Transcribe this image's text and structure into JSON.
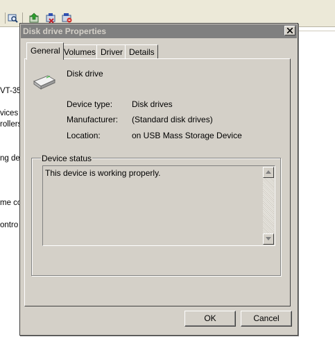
{
  "background_window": {
    "fragments": [
      "VT-35",
      "vices",
      "rollers",
      "ng de",
      "me co",
      "ontro"
    ]
  },
  "toolbar": {
    "icons": [
      "scan-hardware-icon",
      "update-driver-icon",
      "disable-device-icon",
      "uninstall-device-icon"
    ]
  },
  "dialog": {
    "title": "Disk drive Properties",
    "close_label": "X",
    "tabs": [
      "General",
      "Volumes",
      "Driver",
      "Details"
    ],
    "active_tab": "General",
    "device_name": "Disk drive",
    "icon": "disk-drive-icon",
    "properties": [
      {
        "label": "Device type:",
        "value": "Disk drives"
      },
      {
        "label": "Manufacturer:",
        "value": "(Standard disk drives)"
      },
      {
        "label": "Location:",
        "value": "on USB Mass Storage Device"
      }
    ],
    "status_group_title": "Device status",
    "status_text": "This device is working properly.",
    "ok_label": "OK",
    "cancel_label": "Cancel"
  },
  "colors": {
    "dialog_face": "#d4d0c8",
    "title_bar_inactive": "#808080",
    "title_text": "#d4d0c8"
  }
}
